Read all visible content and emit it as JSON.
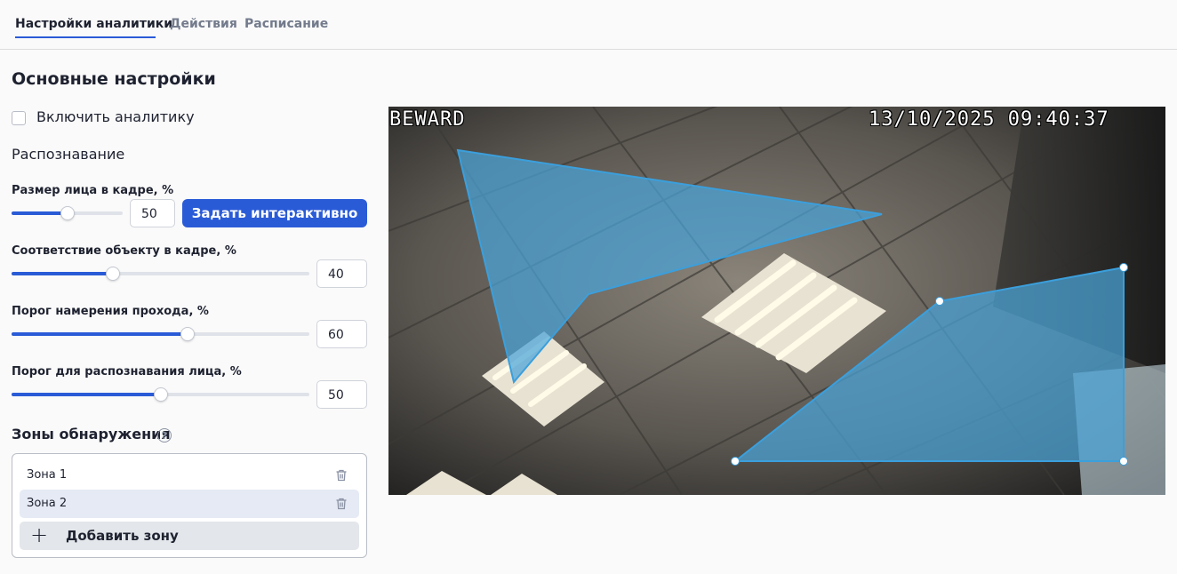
{
  "tabs": [
    {
      "label": "Настройки аналитики",
      "active": true
    },
    {
      "label": "Действия",
      "active": false
    },
    {
      "label": "Расписание",
      "active": false
    }
  ],
  "main_title": "Основные настройки",
  "enable_analytics": {
    "label": "Включить аналитику",
    "checked": false
  },
  "recognition_title": "Распознавание",
  "params": [
    {
      "label": "Размер лица в кадре, %",
      "value": "50",
      "level_percent": 50
    },
    {
      "label": "Соответствие объекту в кадре, %",
      "value": "40",
      "level_percent": 34
    },
    {
      "label": "Порог намерения прохода, %",
      "value": "60",
      "level_percent": 59
    },
    {
      "label": "Порог для распознавания лица, %",
      "value": "50",
      "level_percent": 50
    }
  ],
  "interactive_button": "Задать интерактивно",
  "zones": {
    "title": "Зоны обнаружения",
    "items": [
      {
        "name": "Зона 1",
        "selected": false
      },
      {
        "name": "Зона 2",
        "selected": true
      }
    ],
    "add_label": "Добавить зону"
  },
  "camera": {
    "brand": "BEWARD",
    "timestamp": "13/10/2025 09:40:37"
  },
  "colors": {
    "accent": "#2a5bd7",
    "zone_fill": "#4aa3d8",
    "zone_stroke": "#3b9fdc"
  }
}
